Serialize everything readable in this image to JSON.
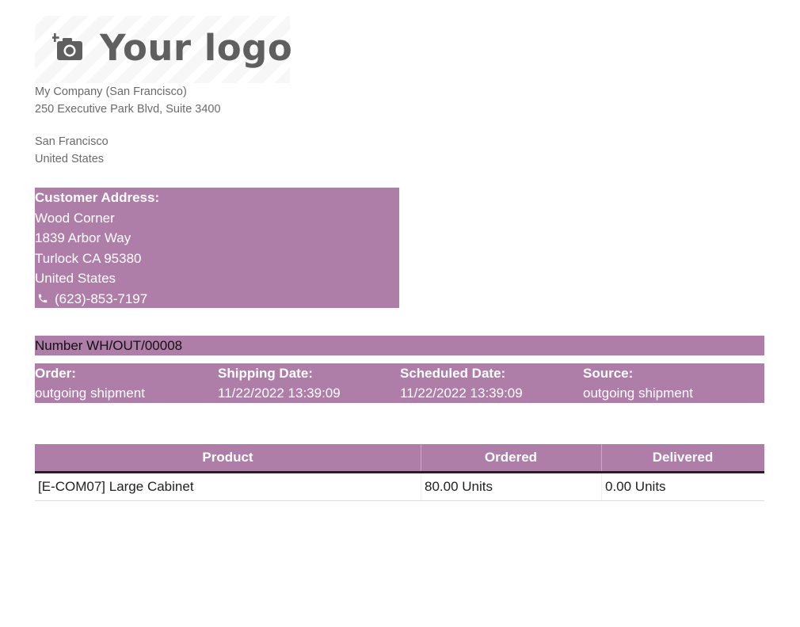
{
  "logo": {
    "text": "Your logo",
    "icon": "camera-plus-icon"
  },
  "company": {
    "name": "My Company (San Francisco)",
    "street": "250 Executive Park Blvd, Suite 3400",
    "city": "San Francisco",
    "country": "United States"
  },
  "customer": {
    "heading": "Customer Address:",
    "name": "Wood Corner",
    "street": "1839 Arbor Way",
    "city": "Turlock CA 95380",
    "country": "United States",
    "phone": "(623)-853-7197",
    "phone_icon": "phone-icon"
  },
  "document": {
    "number": "Number WH/OUT/00008"
  },
  "info": {
    "order_label": "Order:",
    "order_value": "outgoing shipment",
    "shipping_label": "Shipping Date:",
    "shipping_value": "11/22/2022 13:39:09",
    "scheduled_label": "Scheduled Date:",
    "scheduled_value": "11/22/2022 13:39:09",
    "source_label": "Source:",
    "source_value": "outgoing shipment"
  },
  "table": {
    "headers": [
      "Product",
      "Ordered",
      "Delivered"
    ],
    "rows": [
      {
        "product": "[E-COM07] Large Cabinet",
        "ordered": "80.00 Units",
        "delivered": "0.00 Units"
      }
    ]
  },
  "colors": {
    "accent": "#ae7ea9",
    "logo_text": "#5f5f5f"
  }
}
